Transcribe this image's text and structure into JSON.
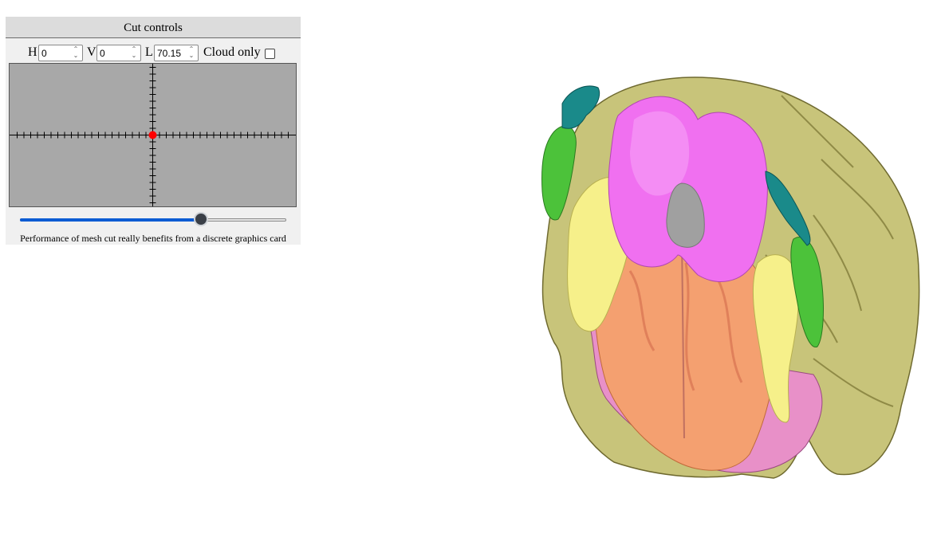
{
  "panel": {
    "title": "Cut controls",
    "h_label": "H",
    "h_value": "0",
    "v_label": "V",
    "v_value": "0",
    "l_label": "L",
    "l_value": "70.15",
    "cloud_label": "Cloud only",
    "cloud_checked": false,
    "slider_level_fraction": 0.68,
    "note": "Performance of mesh cut really benefits from a discrete graphics card"
  },
  "viewport": {
    "object": "3D brain mesh cut",
    "colors": {
      "cortex": "#c8c47a",
      "magenta_region": "#f070f0",
      "orange_region": "#f4a070",
      "yellow_region": "#f6f08a",
      "green_region": "#4cc23a",
      "teal_region": "#1a8a8a",
      "pink_region": "#e890c8",
      "cut_gray": "#a0a0a0"
    }
  }
}
